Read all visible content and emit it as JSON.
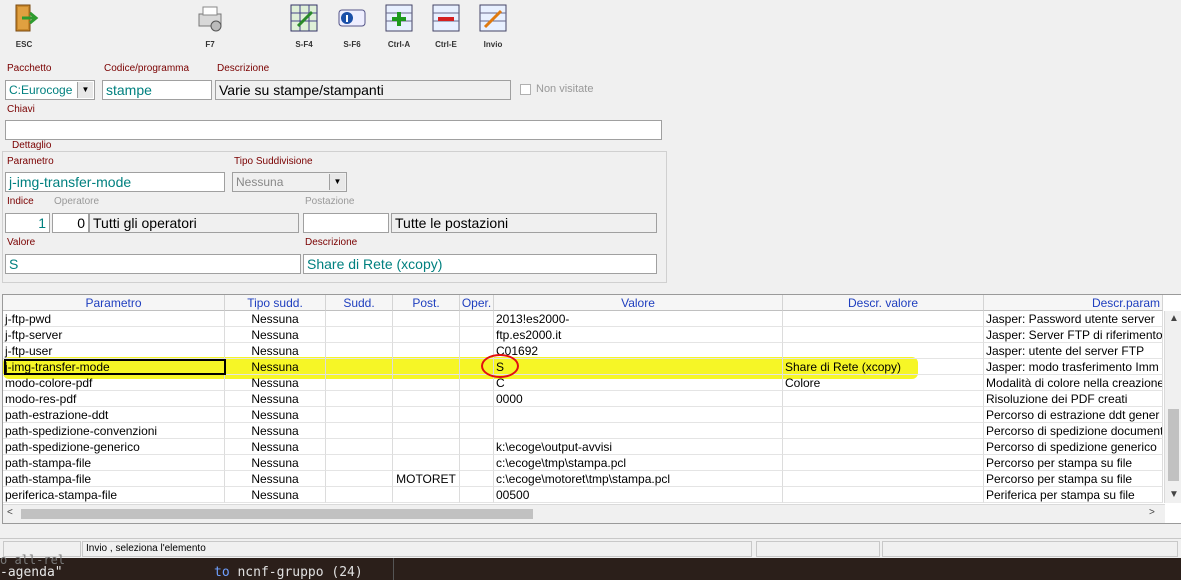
{
  "toolbar": {
    "buttons": [
      {
        "label": "ESC",
        "icon": "exit-door-icon"
      },
      {
        "label": "F7",
        "icon": "printer-gear-icon"
      },
      {
        "label": "S-F4",
        "icon": "grid-edit-icon"
      },
      {
        "label": "S-F6",
        "icon": "toggle-info-icon"
      },
      {
        "label": "Ctrl-A",
        "icon": "add-row-icon"
      },
      {
        "label": "Ctrl-E",
        "icon": "delete-row-icon"
      },
      {
        "label": "Invio",
        "icon": "confirm-edit-icon"
      }
    ]
  },
  "form": {
    "pacchetto": {
      "label": "Pacchetto",
      "value": "C:Eurocoge"
    },
    "codice": {
      "label": "Codice/programma",
      "value": "stampe"
    },
    "descrizione": {
      "label": "Descrizione",
      "value": "Varie su stampe/stampanti"
    },
    "non_visitate": "Non visitate",
    "chiavi": {
      "label": "Chiavi",
      "value": ""
    },
    "dettaglio_title": "Dettaglio",
    "parametro": {
      "label": "Parametro",
      "value": "j-img-transfer-mode"
    },
    "tipo_suddivisione": {
      "label": "Tipo Suddivisione",
      "value": "Nessuna"
    },
    "indice": {
      "label": "Indice",
      "value": "1"
    },
    "operatore": {
      "label": "Operatore",
      "code": "0",
      "desc": "Tutti gli operatori"
    },
    "postazione": {
      "label": "Postazione",
      "code": "",
      "desc": "Tutte le postazioni"
    },
    "valore": {
      "label": "Valore",
      "value": "S"
    },
    "descr_valore": {
      "label": "Descrizione",
      "value": "Share di Rete (xcopy)"
    }
  },
  "grid": {
    "columns": [
      "Parametro",
      "Tipo sudd.",
      "Sudd.",
      "Post.",
      "Oper.",
      "Valore",
      "Descr. valore",
      "Descr.param"
    ],
    "rows": [
      [
        "j-ftp-pwd",
        "Nessuna",
        "",
        "",
        "",
        "2013!es2000-",
        "",
        "Jasper: Password utente server"
      ],
      [
        "j-ftp-server",
        "Nessuna",
        "",
        "",
        "",
        "ftp.es2000.it",
        "",
        "Jasper: Server FTP di riferimento"
      ],
      [
        "j-ftp-user",
        "Nessuna",
        "",
        "",
        "",
        "C01692",
        "",
        "Jasper: utente del server FTP"
      ],
      [
        "j-img-transfer-mode",
        "Nessuna",
        "",
        "",
        "",
        "S",
        "Share di Rete (xcopy)",
        "Jasper: modo trasferimento Imm"
      ],
      [
        "modo-colore-pdf",
        "Nessuna",
        "",
        "",
        "",
        "C",
        "Colore",
        "Modalità di colore nella creazione"
      ],
      [
        "modo-res-pdf",
        "Nessuna",
        "",
        "",
        "",
        "0000",
        "",
        "Risoluzione dei PDF creati"
      ],
      [
        "path-estrazione-ddt",
        "Nessuna",
        "",
        "",
        "",
        "",
        "",
        "Percorso di estrazione ddt gener"
      ],
      [
        "path-spedizione-convenzioni",
        "Nessuna",
        "",
        "",
        "",
        "",
        "",
        "Percorso di spedizione document"
      ],
      [
        "path-spedizione-generico",
        "Nessuna",
        "",
        "",
        "",
        "k:\\ecoge\\output-avvisi",
        "",
        "Percorso di spedizione generico"
      ],
      [
        "path-stampa-file",
        "Nessuna",
        "",
        "",
        "",
        "c:\\ecoge\\tmp\\stampa.pcl",
        "",
        "Percorso per stampa su file"
      ],
      [
        "path-stampa-file",
        "Nessuna",
        "",
        "MOTORET",
        "",
        "c:\\ecoge\\motoret\\tmp\\stampa.pcl",
        "",
        "Percorso per stampa su file"
      ],
      [
        "periferica-stampa-file",
        "Nessuna",
        "",
        "",
        "",
        "00500",
        "",
        "Periferica per stampa su file"
      ]
    ]
  },
  "status": {
    "message": "Invio , seleziona l'elemento"
  },
  "terminal": {
    "line1": "o all-rel",
    "line2": "-agenda\"",
    "keyword": "to",
    "rest": " ncnf-gruppo (24)"
  },
  "colors": {
    "highlight": "#f4f400",
    "annotation_circle": "#e01010",
    "header_text": "#1f3fbf",
    "field_text": "#00807f"
  }
}
